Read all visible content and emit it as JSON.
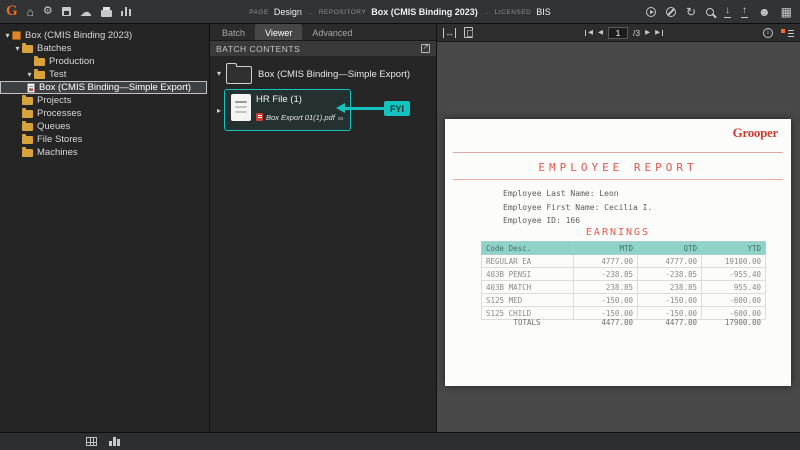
{
  "topbar": {
    "logo": "G",
    "page_label": "PAGE",
    "page_value": "Design",
    "repo_label": "REPOSITORY",
    "repo_value": "Box (CMIS Binding 2023)",
    "license_label": "LICENSED",
    "license_value": "BIS"
  },
  "sidebar": {
    "items": [
      {
        "label": "Box (CMIS Binding 2023)"
      },
      {
        "label": "Batches"
      },
      {
        "label": "Production"
      },
      {
        "label": "Test"
      },
      {
        "label": "Box (CMIS Binding—Simple Export)"
      },
      {
        "label": "Projects"
      },
      {
        "label": "Processes"
      },
      {
        "label": "Queues"
      },
      {
        "label": "File Stores"
      },
      {
        "label": "Machines"
      }
    ]
  },
  "panel": {
    "tabs": [
      {
        "label": "Batch"
      },
      {
        "label": "Viewer"
      },
      {
        "label": "Advanced"
      }
    ],
    "header": "BATCH CONTENTS",
    "folder_label": "Box (CMIS Binding—Simple Export)",
    "file_title": "HR File (1)",
    "file_subtitle": "Box Export 01(1).pdf",
    "annotation": "FYI"
  },
  "viewer": {
    "page_number": "1",
    "page_total": "/3"
  },
  "document": {
    "logo": "Grooper",
    "title": "EMPLOYEE REPORT",
    "info_lines": [
      "Employee Last Name: Leon",
      "Employee First Name: Cecilia I.",
      "Employee ID: 166"
    ],
    "section": "EARNINGS",
    "table": {
      "headers": [
        "Code Desc.",
        "MTD",
        "QTD",
        "YTD"
      ],
      "rows": [
        [
          "REGULAR EA",
          "4777.00",
          "4777.00",
          "19100.00"
        ],
        [
          "403B PENSI",
          "-238.85",
          "-238.85",
          "-955.40"
        ],
        [
          "403B MATCH",
          "238.85",
          "238.85",
          "955.40"
        ],
        [
          "S125 MED",
          "-150.00",
          "-150.00",
          "-600.00"
        ],
        [
          "S125 CHILD",
          "-150.00",
          "-150.00",
          "-600.00"
        ]
      ],
      "totals_label": "TOTALS",
      "totals": [
        "4477.00",
        "4477.00",
        "17900.00"
      ]
    }
  }
}
